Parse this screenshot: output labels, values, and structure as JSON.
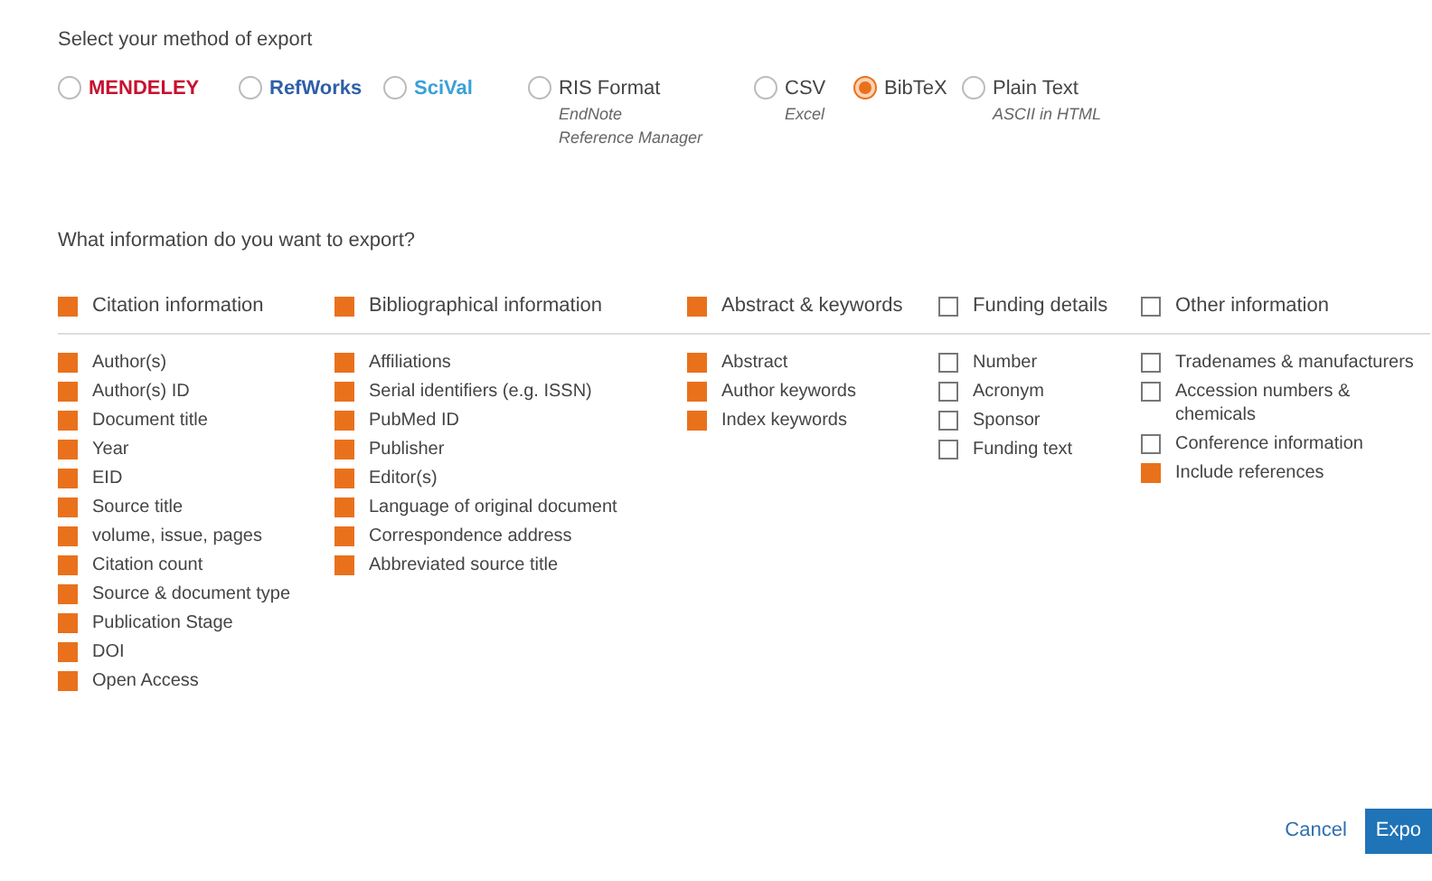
{
  "export_prompt": "Select your method of export",
  "methods": [
    {
      "kind": "logo",
      "label": "MENDELEY",
      "selected": false,
      "color": "#c8102e"
    },
    {
      "kind": "logo",
      "label": "RefWorks",
      "selected": false,
      "color": "#2f5fa8"
    },
    {
      "kind": "logo",
      "label": "SciVal",
      "selected": false,
      "color": "#3aa0d8"
    },
    {
      "kind": "text",
      "label": "RIS Format",
      "sub": [
        "EndNote",
        "Reference Manager"
      ],
      "selected": false
    },
    {
      "kind": "text",
      "label": "CSV",
      "sub": [
        "Excel"
      ],
      "selected": false
    },
    {
      "kind": "text",
      "label": "BibTeX",
      "selected": true
    },
    {
      "kind": "text",
      "label": "Plain Text",
      "sub": [
        "ASCII in HTML"
      ],
      "selected": false
    }
  ],
  "info_prompt": "What information do you want to export?",
  "groups": [
    {
      "label": "Citation information",
      "checked": true,
      "items": [
        {
          "label": "Author(s)",
          "checked": true
        },
        {
          "label": "Author(s) ID",
          "checked": true
        },
        {
          "label": "Document title",
          "checked": true
        },
        {
          "label": "Year",
          "checked": true
        },
        {
          "label": "EID",
          "checked": true
        },
        {
          "label": "Source title",
          "checked": true
        },
        {
          "label": "volume, issue, pages",
          "checked": true
        },
        {
          "label": "Citation count",
          "checked": true
        },
        {
          "label": "Source & document type",
          "checked": true
        },
        {
          "label": "Publication Stage",
          "checked": true
        },
        {
          "label": "DOI",
          "checked": true
        },
        {
          "label": "Open Access",
          "checked": true
        }
      ]
    },
    {
      "label": "Bibliographical information",
      "checked": true,
      "items": [
        {
          "label": "Affiliations",
          "checked": true
        },
        {
          "label": "Serial identifiers (e.g. ISSN)",
          "checked": true
        },
        {
          "label": "PubMed ID",
          "checked": true
        },
        {
          "label": "Publisher",
          "checked": true
        },
        {
          "label": "Editor(s)",
          "checked": true
        },
        {
          "label": "Language of original document",
          "checked": true
        },
        {
          "label": "Correspondence address",
          "checked": true
        },
        {
          "label": "Abbreviated source title",
          "checked": true
        }
      ]
    },
    {
      "label": "Abstract & keywords",
      "checked": true,
      "items": [
        {
          "label": "Abstract",
          "checked": true
        },
        {
          "label": "Author keywords",
          "checked": true
        },
        {
          "label": "Index keywords",
          "checked": true
        }
      ]
    },
    {
      "label": "Funding details",
      "checked": false,
      "items": [
        {
          "label": "Number",
          "checked": false
        },
        {
          "label": "Acronym",
          "checked": false
        },
        {
          "label": "Sponsor",
          "checked": false
        },
        {
          "label": "Funding text",
          "checked": false
        }
      ]
    },
    {
      "label": "Other information",
      "checked": false,
      "items": [
        {
          "label": "Tradenames & manufacturers",
          "checked": false
        },
        {
          "label": "Accession numbers & chemicals",
          "checked": false
        },
        {
          "label": "Conference information",
          "checked": false
        },
        {
          "label": "Include references",
          "checked": true
        }
      ]
    }
  ],
  "buttons": [
    {
      "kind": "link",
      "label": "Cancel"
    },
    {
      "kind": "primary",
      "label": "Expo"
    }
  ]
}
